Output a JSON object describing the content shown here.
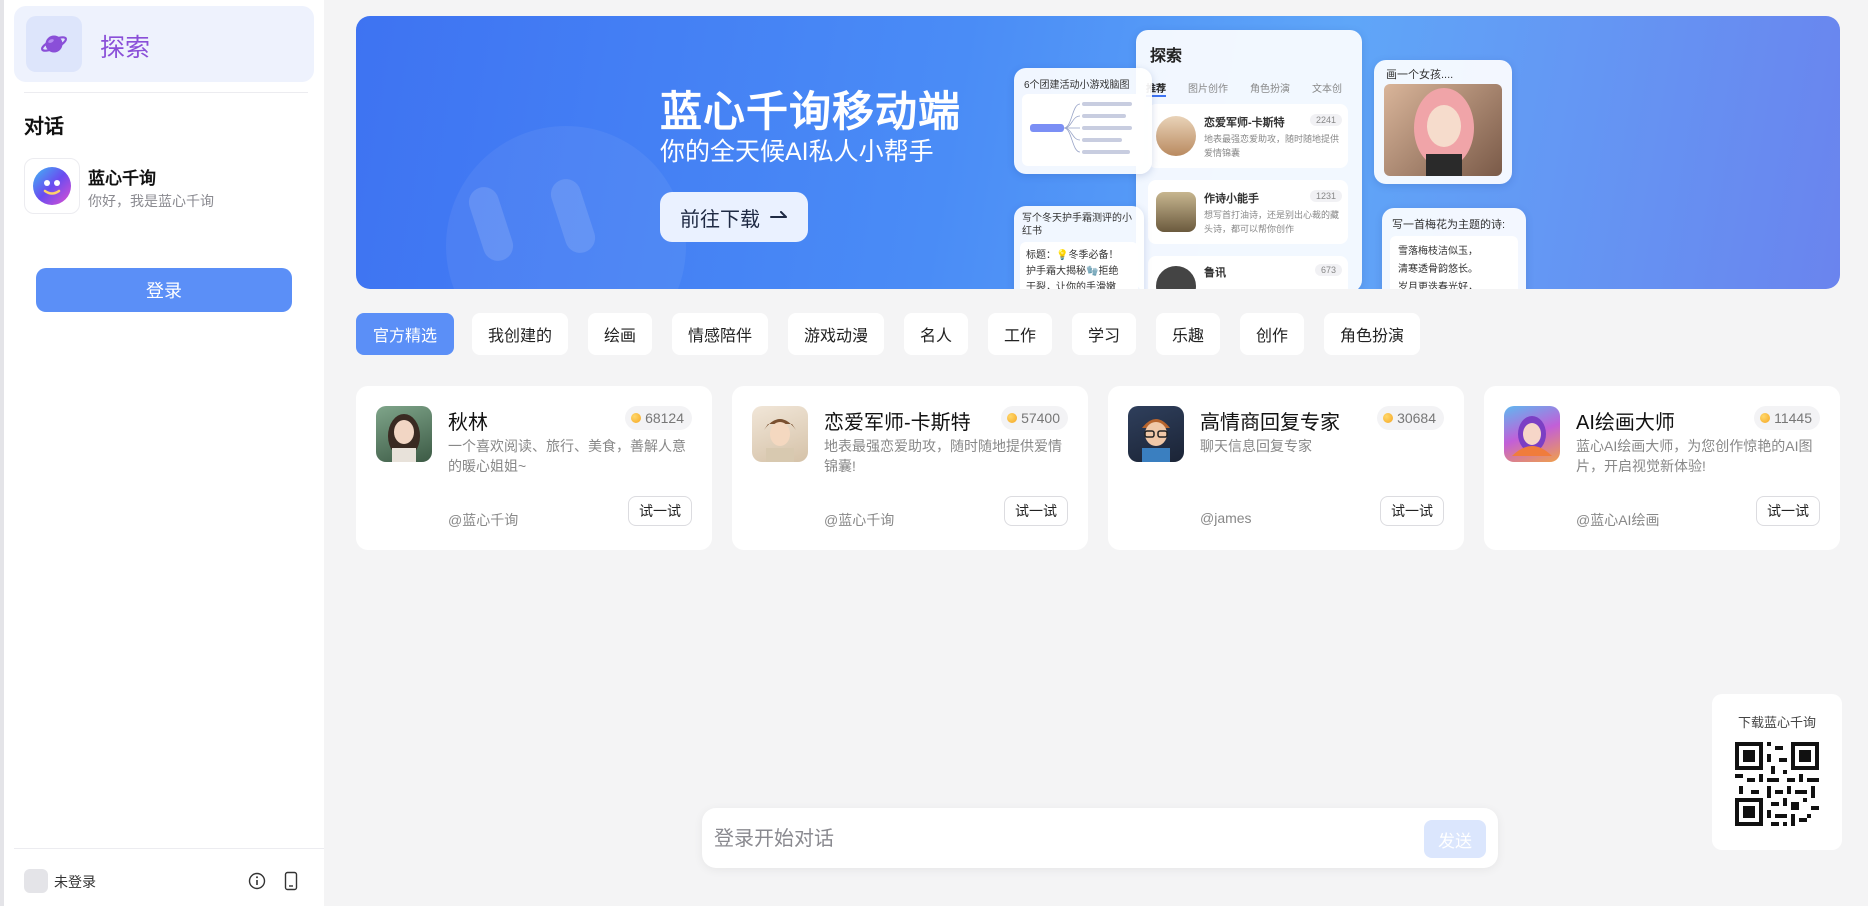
{
  "sidebar": {
    "explore_label": "探索",
    "section_title": "对话",
    "chat": {
      "name": "蓝心千询",
      "subtitle": "你好，我是蓝心千询"
    },
    "login_label": "登录",
    "user_status": "未登录"
  },
  "banner": {
    "title": "蓝心千询移动端",
    "subtitle": "你的全天候AI私人小帮手",
    "button_label": "前往下载",
    "mock": {
      "explore_title": "探索",
      "tabs": [
        "推荐",
        "图片创作",
        "角色扮演",
        "文本创"
      ],
      "items": [
        {
          "name": "恋爱军师-卡斯特",
          "desc": "地表最强恋爱助攻，随时随地提供爱情锦囊",
          "count": "2241"
        },
        {
          "name": "作诗小能手",
          "desc": "想写首打油诗，还是别出心裁的藏头诗，都可以帮你创作",
          "count": "1231"
        },
        {
          "name": "鲁讯",
          "count": "673"
        }
      ],
      "mindmap_title": "6个团建活动小游戏脑图",
      "xhs_title": "写个冬天护手霜测评的小红书",
      "xhs_lines": [
        "标题：💡冬季必备！",
        "护手霜大揭秘🧤拒绝",
        "干裂，让你的手滑嫩"
      ],
      "girl_title": "画一个女孩....",
      "poem_title": "写一首梅花为主题的诗:",
      "poem_lines": [
        "雪落梅枝洁似玉，",
        "清寒透骨韵悠长。",
        "岁月更迭春光好，"
      ]
    }
  },
  "tabs": [
    "官方精选",
    "我创建的",
    "绘画",
    "情感陪伴",
    "游戏动漫",
    "名人",
    "工作",
    "学习",
    "乐趣",
    "创作",
    "角色扮演"
  ],
  "cards": [
    {
      "title": "秋林",
      "count": "68124",
      "desc": "一个喜欢阅读、旅行、美食，善解人意的暖心姐姐~",
      "author": "@蓝心千询",
      "try_label": "试一试"
    },
    {
      "title": "恋爱军师-卡斯特",
      "count": "57400",
      "desc": "地表最强恋爱助攻，随时随地提供爱情锦囊!",
      "author": "@蓝心千询",
      "try_label": "试一试"
    },
    {
      "title": "高情商回复专家",
      "count": "30684",
      "desc": "聊天信息回复专家",
      "author": "@james",
      "try_label": "试一试"
    },
    {
      "title": "AI绘画大师",
      "count": "11445",
      "desc": "蓝心AI绘画大师，为您创作惊艳的AI图片，开启视觉新体验!",
      "author": "@蓝心AI绘画",
      "try_label": "试一试"
    }
  ],
  "qr": {
    "label": "下载蓝心千询"
  },
  "chat_input": {
    "placeholder": "登录开始对话",
    "send_label": "发送"
  },
  "colors": {
    "accent": "#5b8ff7",
    "explore": "#8a4fd8",
    "send_disabled": "#dbe6fd"
  }
}
